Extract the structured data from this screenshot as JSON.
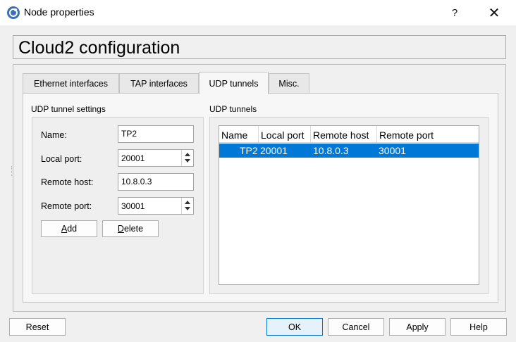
{
  "window": {
    "title": "Node properties",
    "help_symbol": "?",
    "close_symbol": "✕"
  },
  "header": {
    "title": "Cloud2 configuration"
  },
  "tabs": [
    {
      "label": "Ethernet interfaces",
      "active": false
    },
    {
      "label": "TAP interfaces",
      "active": false
    },
    {
      "label": "UDP tunnels",
      "active": true
    },
    {
      "label": "Misc.",
      "active": false
    }
  ],
  "settings": {
    "group_title": "UDP tunnel settings",
    "name_label": "Name:",
    "name_value": "TP2",
    "local_port_label": "Local port:",
    "local_port_value": "20001",
    "remote_host_label": "Remote host:",
    "remote_host_value": "10.8.0.3",
    "remote_port_label": "Remote port:",
    "remote_port_value": "30001",
    "add_button": {
      "mnemonic": "A",
      "rest": "dd"
    },
    "delete_button": {
      "mnemonic": "D",
      "rest": "elete"
    }
  },
  "tunnels": {
    "group_title": "UDP tunnels",
    "columns": [
      "Name",
      "Local port",
      "Remote host",
      "Remote port"
    ],
    "rows": [
      {
        "name": "TP2",
        "local_port": "20001",
        "remote_host": "10.8.0.3",
        "remote_port": "30001",
        "selected": true
      }
    ]
  },
  "footer": {
    "reset": "Reset",
    "ok": "OK",
    "cancel": "Cancel",
    "apply": "Apply",
    "help": "Help"
  },
  "colors": {
    "selection": "#0078d7",
    "dialog_bg": "#f0f0f0"
  }
}
